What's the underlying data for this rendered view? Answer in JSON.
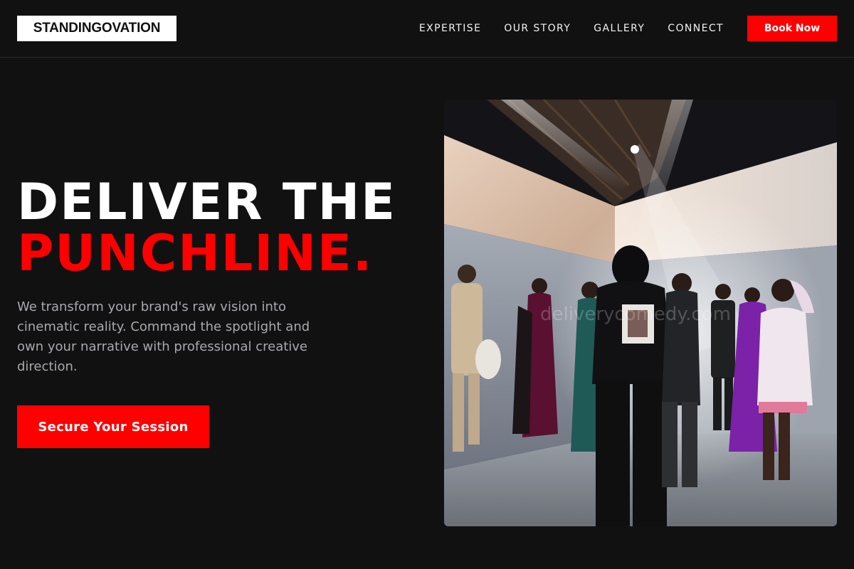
{
  "header": {
    "logo_text": "STANDINGOVATION",
    "nav": [
      {
        "label": "EXPERTISE"
      },
      {
        "label": "OUR STORY"
      },
      {
        "label": "GALLERY"
      },
      {
        "label": "CONNECT"
      }
    ],
    "book_label": "Book Now"
  },
  "hero": {
    "title_line1": "DELIVER THE",
    "title_line2": "PUNCHLINE.",
    "body": "We transform your brand's raw vision into cinematic reality. Command the spotlight and own your narrative with professional creative direction.",
    "cta_label": "Secure Your Session",
    "image_watermark": "deliverycomedy.com"
  },
  "colors": {
    "background": "#111112",
    "accent": "#ff0000",
    "text": "#ffffff",
    "muted_text": "#a9a9ae"
  }
}
